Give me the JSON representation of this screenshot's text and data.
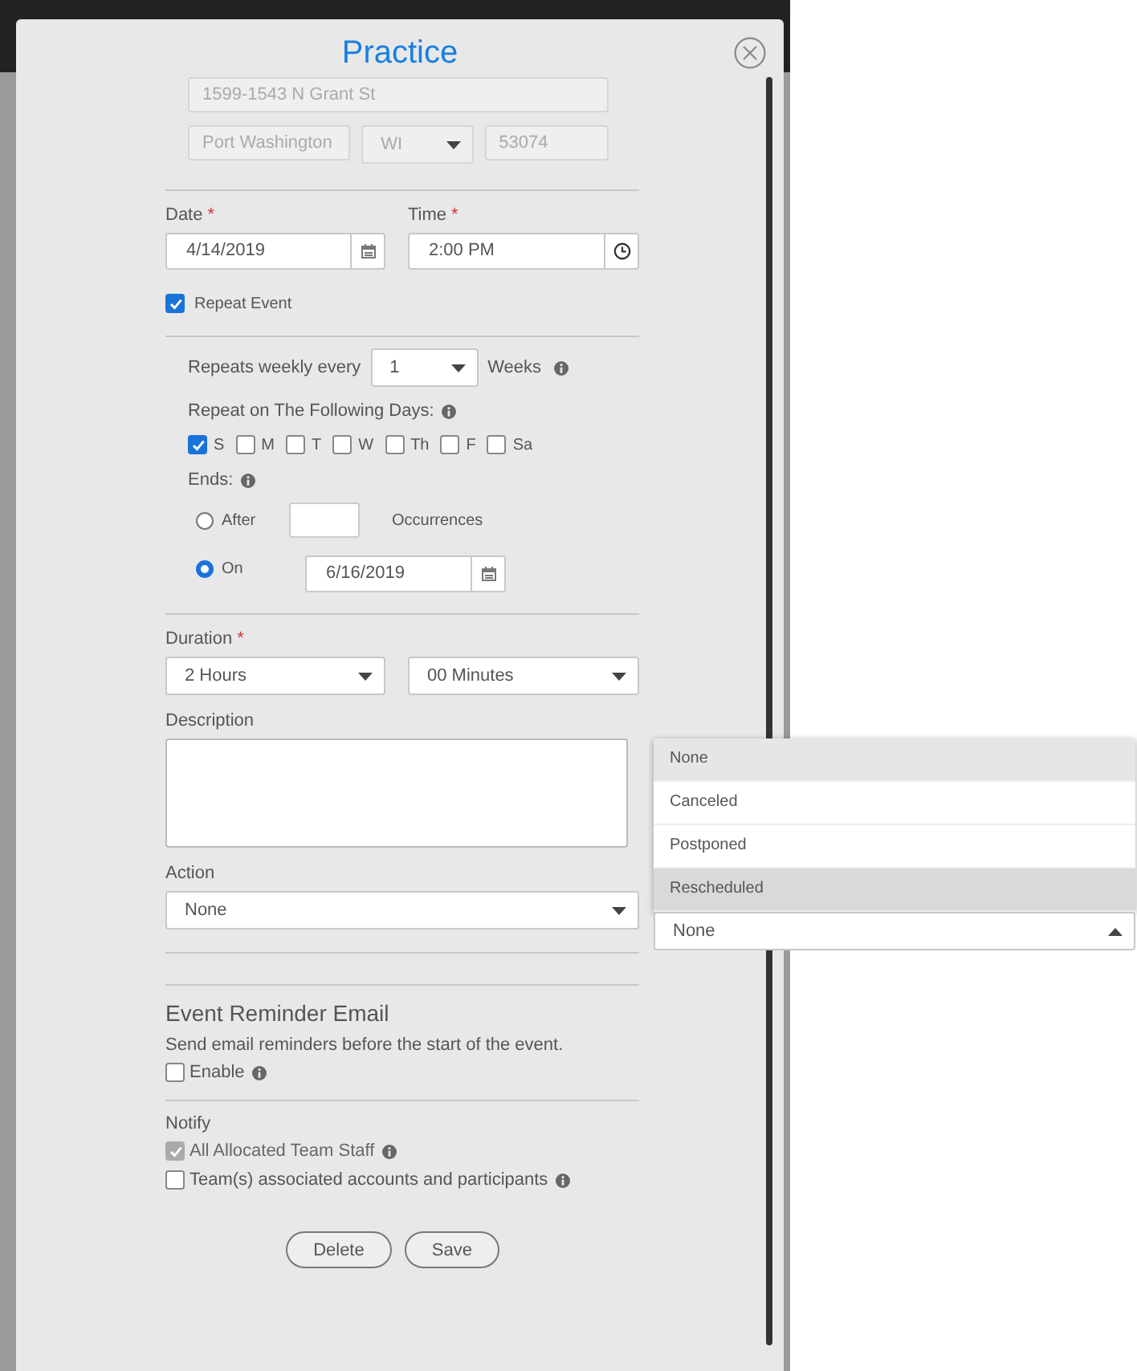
{
  "dialog": {
    "title": "Practice"
  },
  "address": {
    "disabled": true,
    "street": "1599-1543 N Grant St",
    "city": "Port Washington",
    "state": "WI",
    "zip": "53074"
  },
  "date": {
    "label": "Date",
    "required_mark": "*",
    "value": "4/14/2019"
  },
  "time": {
    "label": "Time",
    "required_mark": "*",
    "value": "2:00 PM"
  },
  "repeat_event": {
    "label": "Repeat Event",
    "checked": true
  },
  "recurrence": {
    "every_label": "Repeats weekly every",
    "every_value": "1",
    "unit": "Weeks",
    "days_label": "Repeat on The Following Days:",
    "days": [
      {
        "label": "S",
        "checked": true
      },
      {
        "label": "M",
        "checked": false
      },
      {
        "label": "T",
        "checked": false
      },
      {
        "label": "W",
        "checked": false
      },
      {
        "label": "Th",
        "checked": false
      },
      {
        "label": "F",
        "checked": false
      },
      {
        "label": "Sa",
        "checked": false
      }
    ],
    "ends_label": "Ends:",
    "end_options": [
      {
        "kind": "count",
        "label": "After",
        "selected": false,
        "suffix": "Occurrences"
      },
      {
        "kind": "date",
        "label": "On",
        "selected": true,
        "value": "6/16/2019"
      }
    ]
  },
  "duration": {
    "label": "Duration",
    "required_mark": "*",
    "hours": "2 Hours",
    "minutes": "00 Minutes"
  },
  "description": {
    "label": "Description"
  },
  "action": {
    "label": "Action",
    "value": "None"
  },
  "status_dropdown": {
    "value": "None",
    "expanded": true,
    "options": [
      {
        "label": "None",
        "selected": true,
        "hovered": false
      },
      {
        "label": "Canceled",
        "selected": false,
        "hovered": false
      },
      {
        "label": "Postponed",
        "selected": false,
        "hovered": false
      },
      {
        "label": "Rescheduled",
        "selected": false,
        "hovered": true
      }
    ]
  },
  "reminder": {
    "title": "Event Reminder Email",
    "text": "Send email reminders before the start of the event.",
    "enable": {
      "label": "Enable",
      "checked": false
    }
  },
  "notify": {
    "label": "Notify",
    "options": [
      {
        "label": "All Allocated Team Staff",
        "checked": true,
        "disabled": true
      },
      {
        "label": "Team(s) associated accounts and participants",
        "checked": false,
        "disabled": false
      }
    ]
  },
  "buttons": [
    {
      "label": "Delete"
    },
    {
      "label": "Save"
    }
  ]
}
